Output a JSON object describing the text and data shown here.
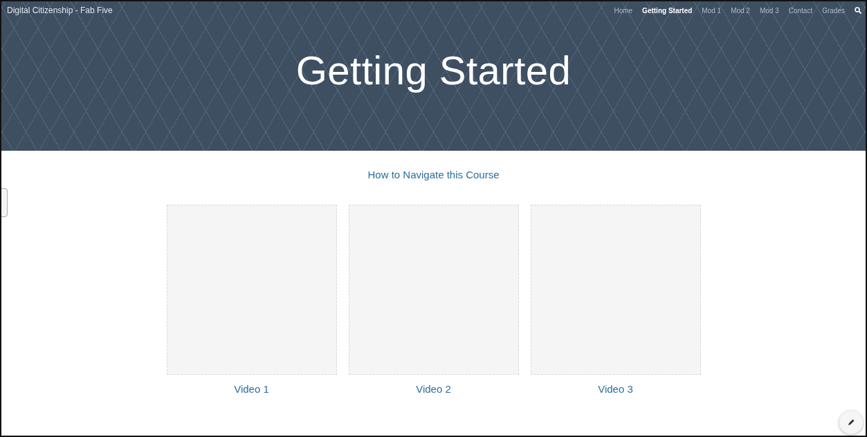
{
  "site_title": "Digital Citizenship - Fab Five",
  "nav": [
    {
      "label": "Home",
      "selected": false
    },
    {
      "label": "Getting Started",
      "selected": true
    },
    {
      "label": "Mod 1",
      "selected": false
    },
    {
      "label": "Mod 2",
      "selected": false
    },
    {
      "label": "Mod 3",
      "selected": false
    },
    {
      "label": "Contact",
      "selected": false
    },
    {
      "label": "Grades",
      "selected": false
    }
  ],
  "page_title": "Getting Started",
  "section_link": "How to Navigate this Course",
  "videos": [
    {
      "label": "Video 1"
    },
    {
      "label": "Video 2"
    },
    {
      "label": "Video 3"
    }
  ]
}
